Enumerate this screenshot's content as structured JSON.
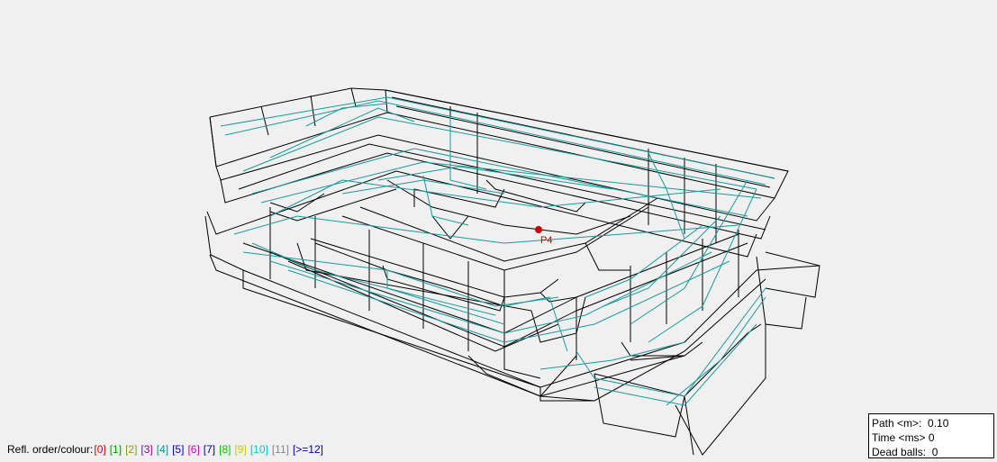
{
  "point_marker": {
    "label": "P4",
    "color": "#cc0000"
  },
  "legend": {
    "label": "Refl. order/colour:",
    "items": [
      {
        "text": "[0]",
        "color": "#cc0000"
      },
      {
        "text": "[1]",
        "color": "#009900"
      },
      {
        "text": "[2]",
        "color": "#999900"
      },
      {
        "text": "[3]",
        "color": "#990099"
      },
      {
        "text": "[4]",
        "color": "#009999"
      },
      {
        "text": "[5]",
        "color": "#0000cc"
      },
      {
        "text": "[6]",
        "color": "#cc00cc"
      },
      {
        "text": "[7]",
        "color": "#000088"
      },
      {
        "text": "[8]",
        "color": "#00cc00"
      },
      {
        "text": "[9]",
        "color": "#cccc00"
      },
      {
        "text": "[10]",
        "color": "#00cccc"
      },
      {
        "text": "[11]",
        "color": "#888888"
      },
      {
        "text": "[>=12]",
        "color": "#000099"
      }
    ]
  },
  "stats": {
    "path_label": "Path <m>:",
    "path_value": "0.10",
    "time_label": "Time <ms>",
    "time_value": "0",
    "dead_label": "Dead balls:",
    "dead_value": "0"
  },
  "colors": {
    "wire": "#000000",
    "ray": "#1a9a9a",
    "background": "#f0f0f0"
  }
}
